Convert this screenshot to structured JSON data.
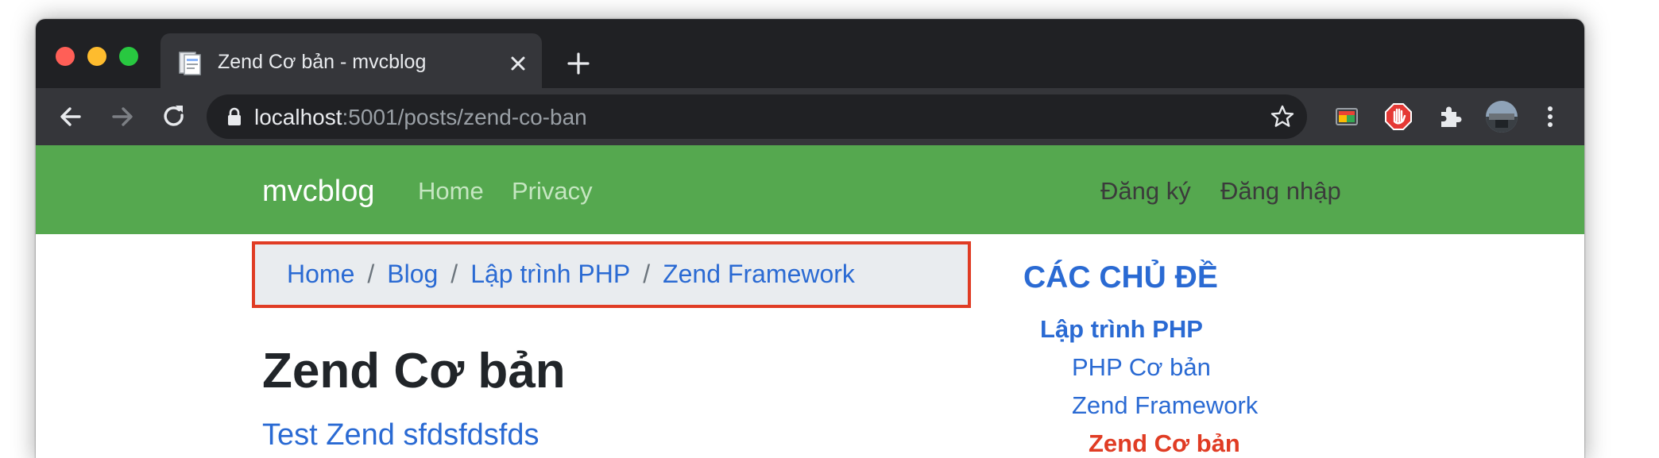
{
  "browser": {
    "tab_title": "Zend Cơ bản - mvcblog",
    "url_host": "localhost",
    "url_rest": ":5001/posts/zend-co-ban",
    "colors": {
      "frame": "#202124",
      "toolbar": "#35363a",
      "close": "#ff5f57",
      "minimize": "#febc2e",
      "maximize": "#28c840"
    },
    "icons": [
      "back-icon",
      "forward-icon",
      "reload-icon",
      "lock-icon",
      "star-icon",
      "cast-icon",
      "adblock-icon",
      "extensions-icon",
      "profile-avatar",
      "menu-icon"
    ]
  },
  "navbar": {
    "brand": "mvcblog",
    "links": [
      "Home",
      "Privacy"
    ],
    "right_links": [
      "Đăng ký",
      "Đăng nhập"
    ],
    "color": "#55a84f"
  },
  "breadcrumb": {
    "items": [
      "Home",
      "Blog",
      "Lập trình PHP",
      "Zend Framework"
    ],
    "separator": "/",
    "highlight_color": "#e03c24"
  },
  "post": {
    "title": "Zend Cơ bản",
    "subtitle": "Test Zend sfdsfdsfds"
  },
  "sidebar": {
    "heading": "CÁC CHỦ ĐỀ",
    "category": "Lập trình PHP",
    "topics": [
      "PHP Cơ bản",
      "Zend Framework"
    ],
    "active_topic": "Zend Cơ bản",
    "link_color": "#2a6ad3",
    "active_color": "#e03c24"
  }
}
